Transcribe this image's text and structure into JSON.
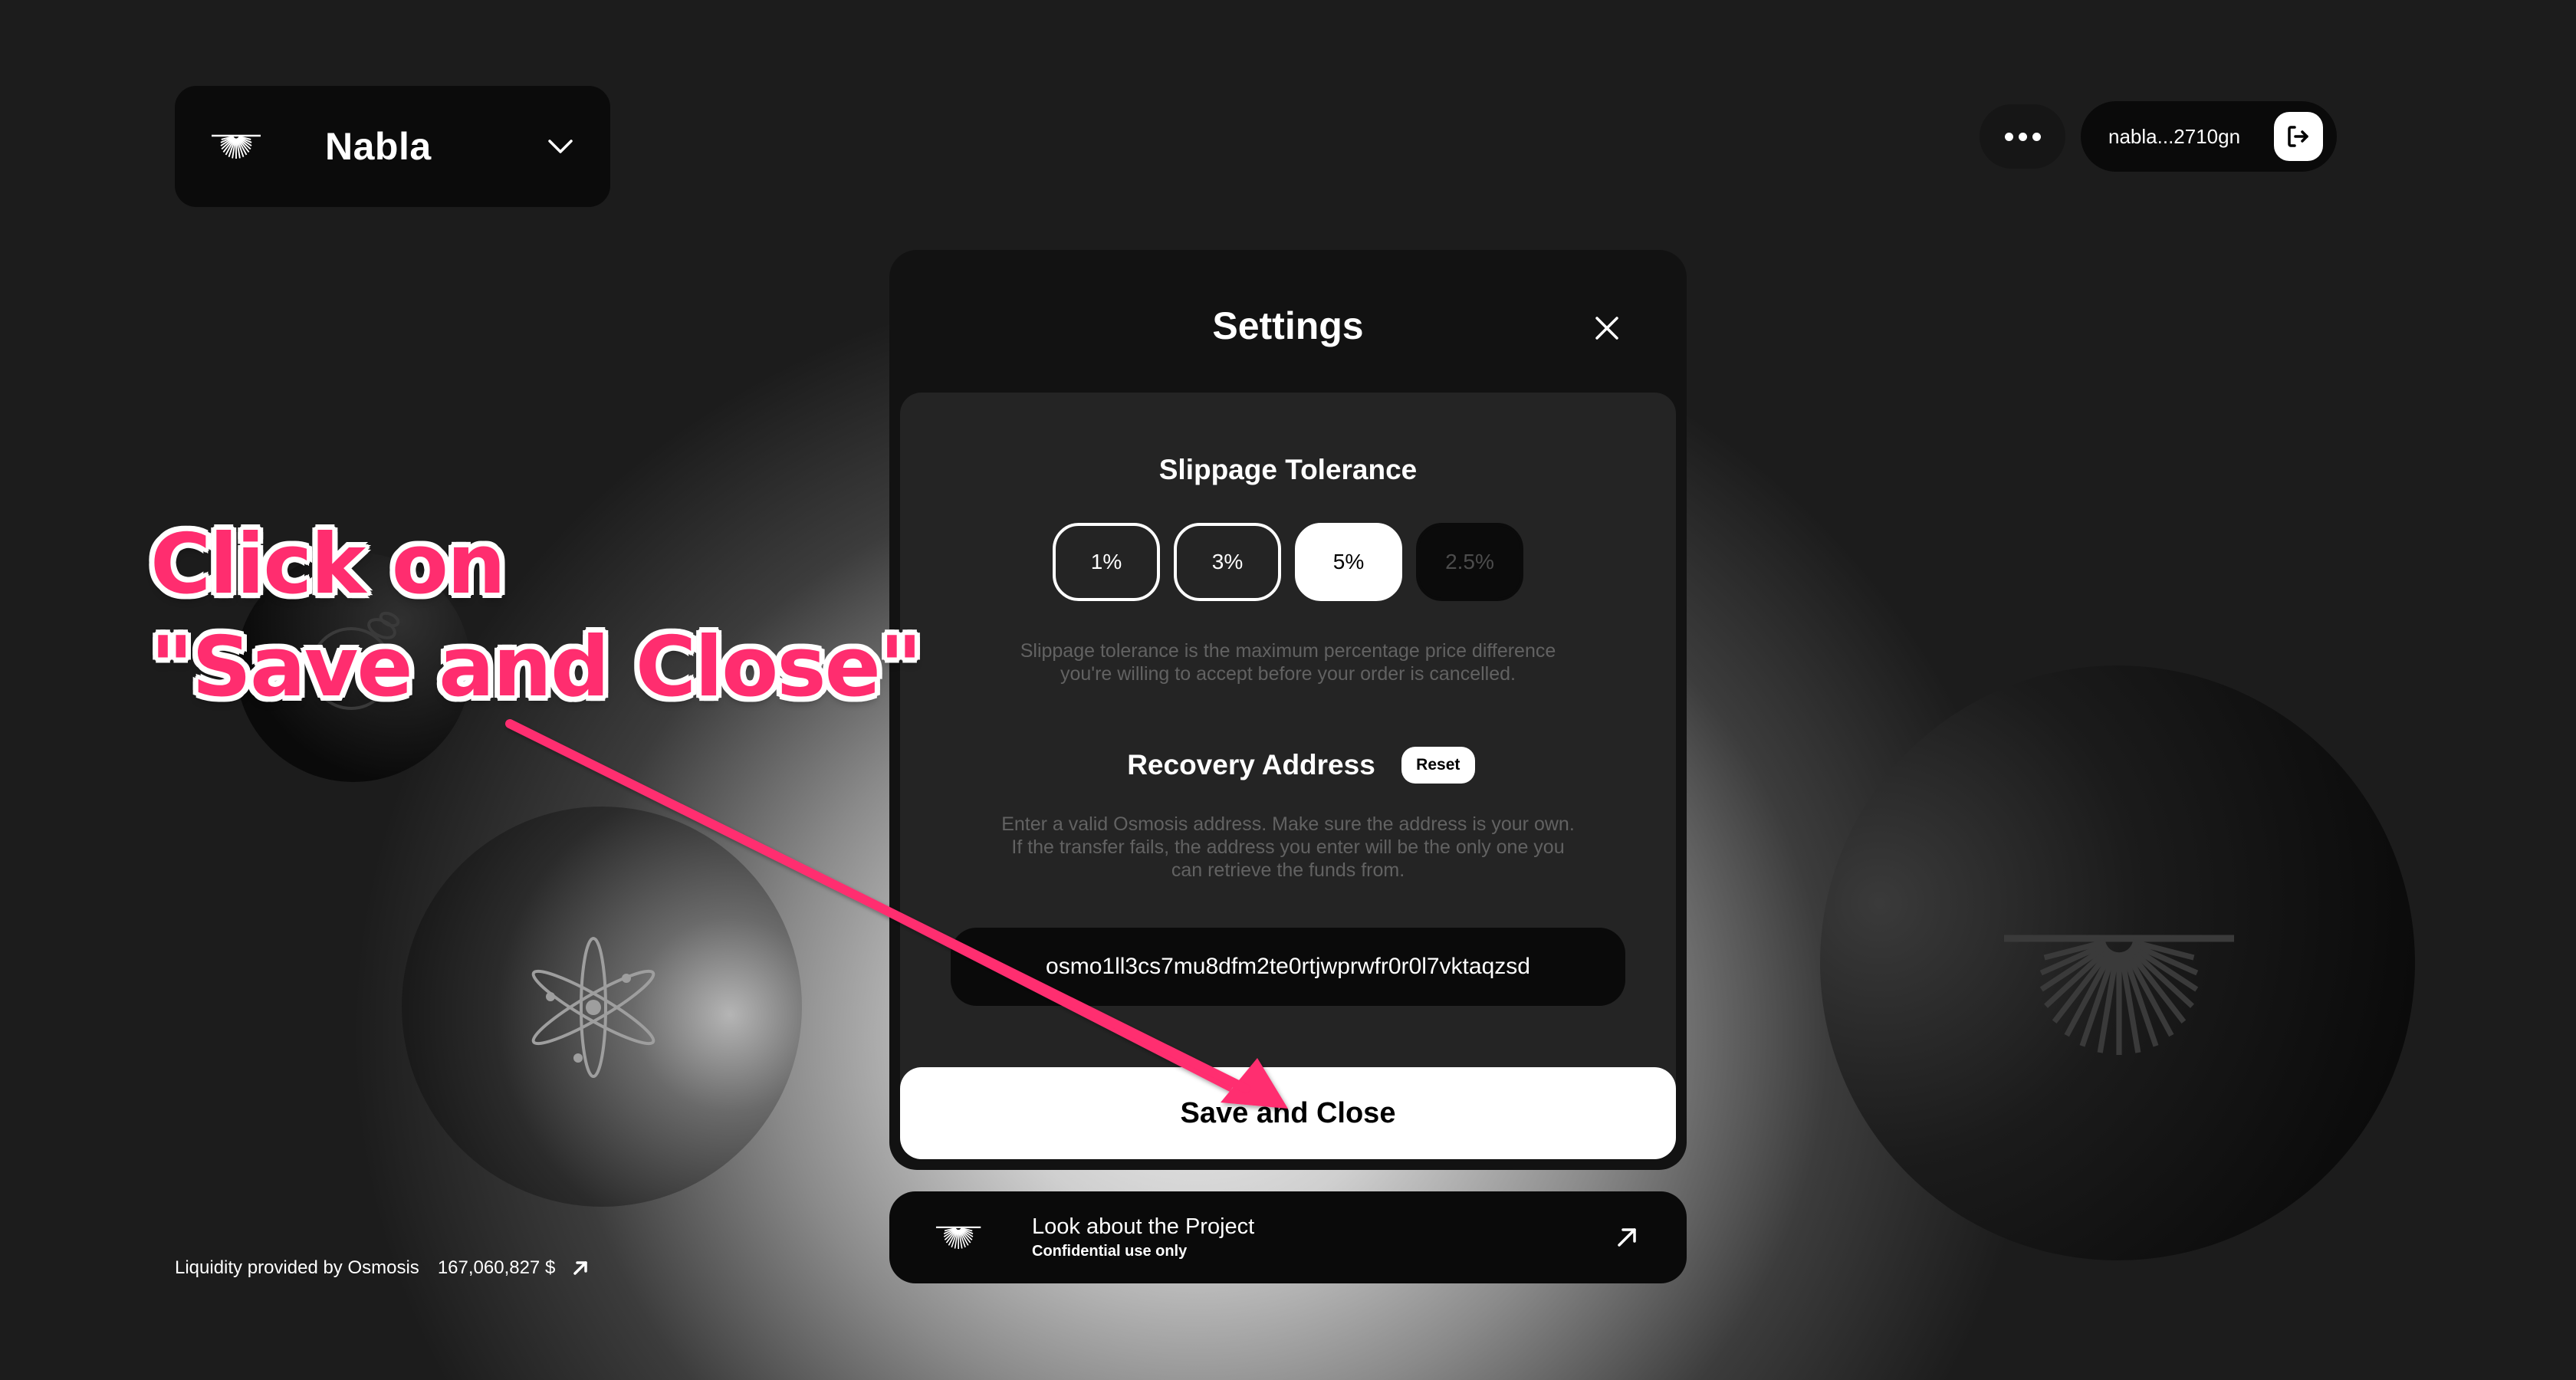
{
  "brand": {
    "name": "Nabla",
    "logo_icon": "nabla-logo-icon",
    "dropdown_icon": "chevron-down-icon"
  },
  "header": {
    "more_icon": "more-horizontal-icon",
    "wallet_address": "nabla...2710gn",
    "logout_icon": "logout-icon"
  },
  "modal": {
    "title": "Settings",
    "close_icon": "close-icon",
    "slippage": {
      "title": "Slippage Tolerance",
      "options": [
        {
          "label": "1%",
          "state": "outlined"
        },
        {
          "label": "3%",
          "state": "outlined"
        },
        {
          "label": "5%",
          "state": "selected"
        },
        {
          "label": "2.5%",
          "state": "custom-placeholder"
        }
      ],
      "selected": "5%",
      "help_line1": "Slippage tolerance is the maximum percentage price difference",
      "help_line2": "you're willing to accept before your order is cancelled."
    },
    "recovery": {
      "title": "Recovery Address",
      "reset_label": "Reset",
      "help_line1": "Enter a valid Osmosis address. Make sure the address is your own.",
      "help_line2": "If the transfer fails, the address you enter will be the only one you",
      "help_line3": "can retrieve the funds from.",
      "address_value": "osmo1ll3cs7mu8dfm2te0rtjwprwfr0r0l7vktaqzsd"
    },
    "save_label": "Save and Close"
  },
  "project_card": {
    "title": "Look about the Project",
    "subtitle": "Confidential use only",
    "link_icon": "arrow-up-right-icon"
  },
  "footer": {
    "liquidity_label": "Liquidity provided by Osmosis",
    "liquidity_amount": "167,060,827 $",
    "link_icon": "arrow-up-right-icon"
  },
  "decor": {
    "circle_icons": [
      "osmosis-icon",
      "cosmos-atom-icon",
      "nabla-logo-icon"
    ]
  },
  "annotation": {
    "line1": "Click on",
    "line2": "\"Save and Close\"",
    "color": "#ff2d6f"
  }
}
